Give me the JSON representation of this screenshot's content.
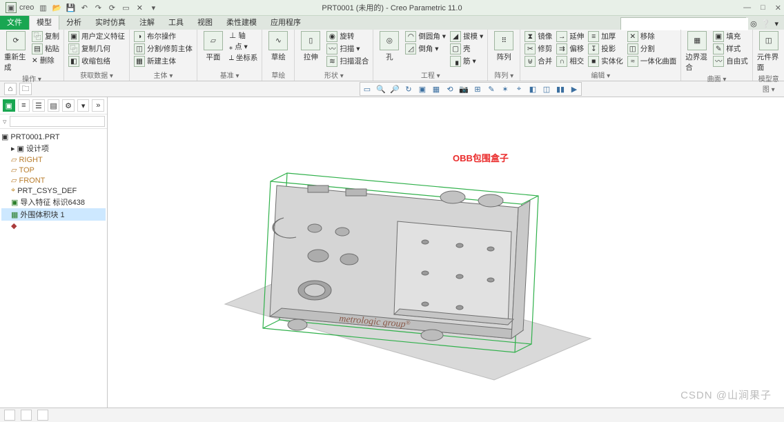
{
  "window": {
    "product": "creo",
    "title": "PRT0001 (未用的) - Creo Parametric 11.0"
  },
  "win_btns": {
    "min": "—",
    "max": "□",
    "close": "✕"
  },
  "tabs": {
    "file": "文件",
    "model": "模型",
    "analysis": "分析",
    "realtime": "实时仿真",
    "annotate": "注解",
    "tool": "工具",
    "view": "视图",
    "flex": "柔性建模",
    "app": "应用程序"
  },
  "search": {
    "placeholder": ""
  },
  "ribbon": {
    "g_ops": {
      "title": "操作 ▾",
      "regen": "重新生成",
      "copy": "复制",
      "paste": "粘贴",
      "del": "✕ 删除"
    },
    "g_data": {
      "title": "获取数据 ▾",
      "udf": "用户定义特征",
      "copygeom": "复制几何",
      "shrink": "收缩包络"
    },
    "g_plane": {
      "title": "基准 ▾",
      "plane": "平面",
      "axis": "⊥ 轴",
      "pt": "⁎ 点 ▾",
      "csys": "⟂ 坐标系"
    },
    "g_intent": {
      "title": "主体 ▾",
      "bool": "布尔操作",
      "split": "分割/修剪主体",
      "newbody": "新建主体"
    },
    "g_sketch": {
      "title": "草绘",
      "sketch": "草绘"
    },
    "g_shape": {
      "title": "形状 ▾",
      "extrude": "拉伸",
      "revolve": "旋转",
      "sweep": "扫描 ▾",
      "blend": "扫描混合"
    },
    "g_eng": {
      "title": "工程 ▾",
      "hole": "孔",
      "round": "倒圆角 ▾",
      "chamfer": "倒角 ▾",
      "draft": "拔模 ▾",
      "shell": "壳",
      "rib": "筋 ▾"
    },
    "g_pattern": {
      "title": "阵列 ▾",
      "pattern": "阵列"
    },
    "g_edit": {
      "title": "编辑 ▾",
      "mirror": "镜像",
      "trim": "修剪",
      "merge": "合并",
      "ext": "延伸",
      "offset": "偏移",
      "intsct": "相交",
      "thick": "加厚",
      "project": "投影",
      "solidify": "实体化",
      "remove": "移除",
      "splitsrf": "分割",
      "integrate": "一体化曲面"
    },
    "g_surf": {
      "title": "曲面 ▾",
      "fill": "填充",
      "style": "样式",
      "bound": "边界混合",
      "free": "自由式"
    },
    "g_comp": {
      "title": "模型意图 ▾",
      "comp": "元件界面"
    }
  },
  "tree": {
    "root": "PRT0001.PRT",
    "design": "设计项",
    "right": "RIGHT",
    "top": "TOP",
    "front": "FRONT",
    "csys": "PRT_CSYS_DEF",
    "import": "导入特征 标识6438",
    "obb": "外围体积块 1"
  },
  "annotation": "OBB包围盒子",
  "watermark": "CSDN @山涧果子"
}
